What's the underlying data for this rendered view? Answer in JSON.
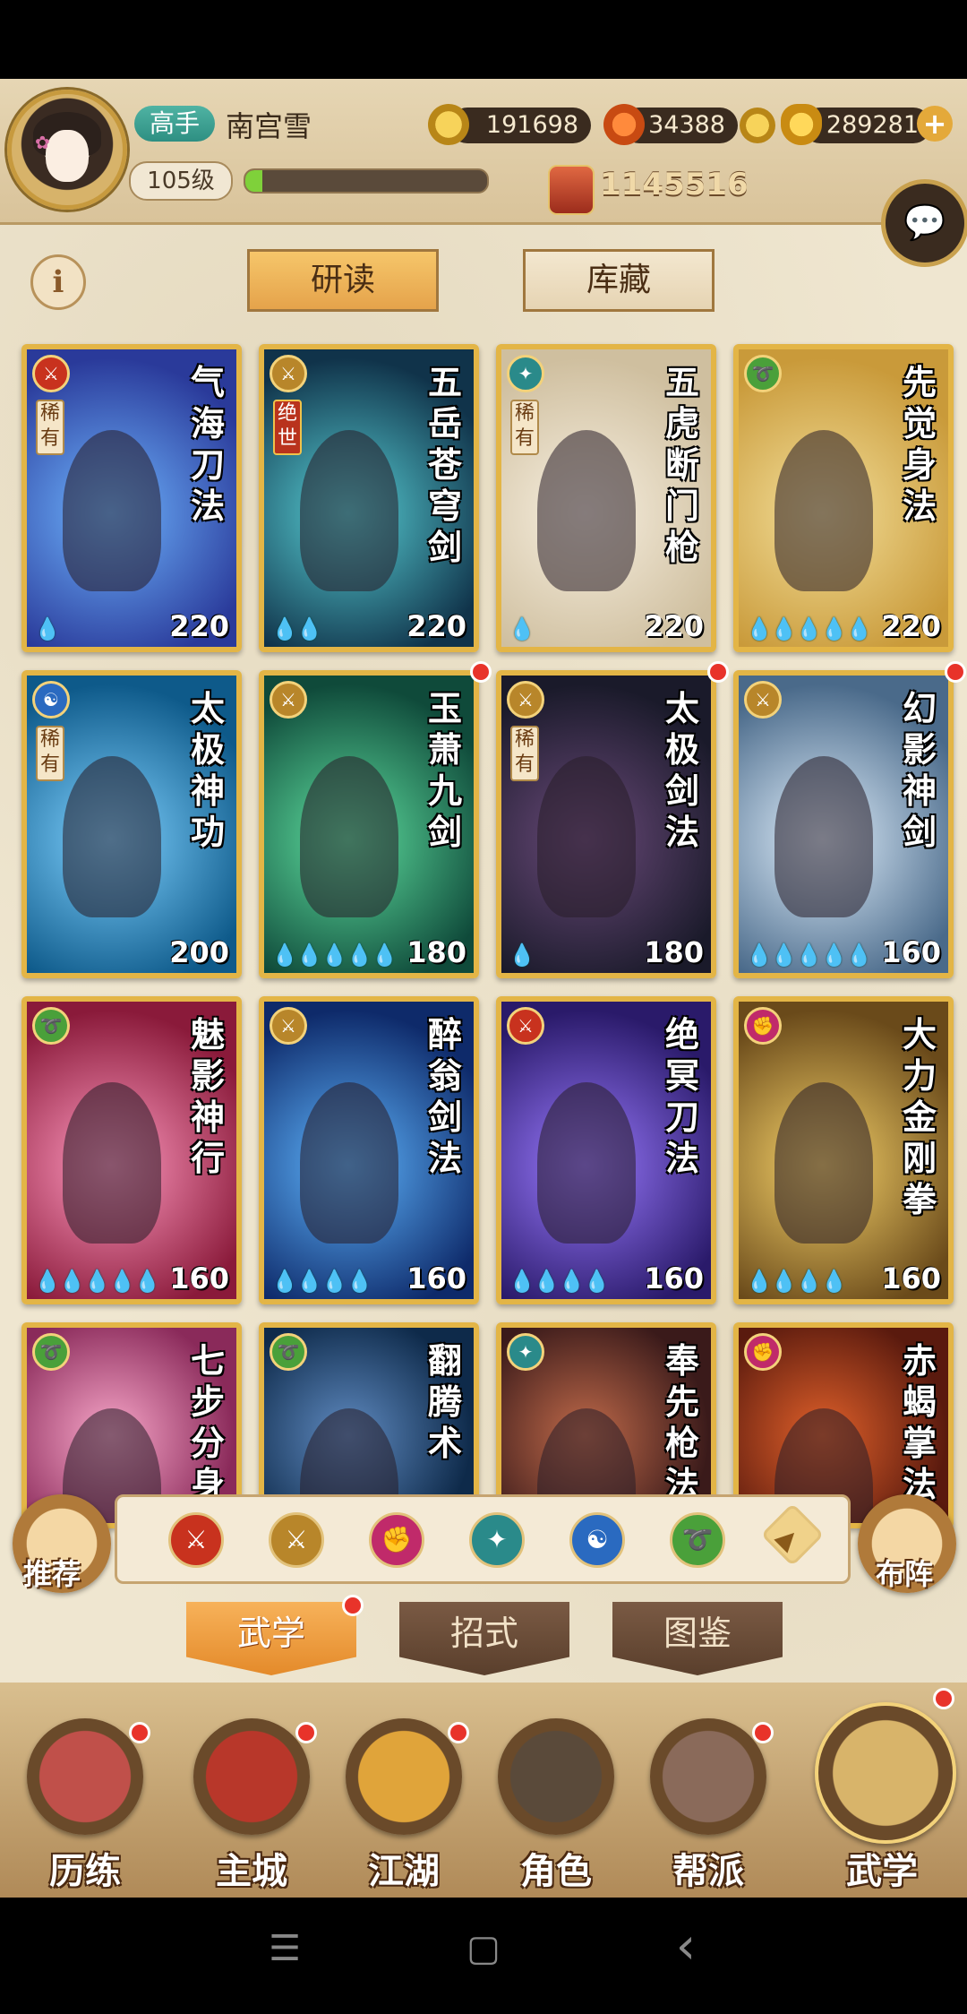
{
  "player": {
    "rank": "高手",
    "name": "南宫雪",
    "level": "105级",
    "exp_fraction": 0.07,
    "power": "1145516"
  },
  "currencies": {
    "coins": "191698",
    "leaves": "34388",
    "ingots": "289281"
  },
  "tabs": {
    "read": "研读",
    "storage": "库藏"
  },
  "cards": [
    {
      "name": "气海刀法",
      "rarity": "稀有",
      "drops": 1,
      "level": "220",
      "element": "red",
      "bg": [
        "#2a3a9a",
        "#6fb6ff"
      ],
      "dot": false
    },
    {
      "name": "五岳苍穹剑",
      "rarity": "绝世",
      "drops": 2,
      "level": "220",
      "element": "gold",
      "bg": [
        "#10334a",
        "#58d0d6"
      ],
      "dot": false
    },
    {
      "name": "五虎断门枪",
      "rarity": "稀有",
      "drops": 1,
      "level": "220",
      "element": "teal",
      "bg": [
        "#cfbf9f",
        "#f7efe0"
      ],
      "dot": false
    },
    {
      "name": "先觉身法",
      "rarity": "",
      "drops": 5,
      "level": "220",
      "element": "green",
      "bg": [
        "#c99a3a",
        "#f3df9a"
      ],
      "dot": false
    },
    {
      "name": "太极神功",
      "rarity": "稀有",
      "drops": 0,
      "level": "200",
      "element": "blue",
      "bg": [
        "#0e5a8a",
        "#7fd1ff"
      ],
      "dot": false
    },
    {
      "name": "玉萧九剑",
      "rarity": "",
      "drops": 5,
      "level": "180",
      "element": "gold",
      "bg": [
        "#0f4a3a",
        "#5fe0a0"
      ],
      "dot": true
    },
    {
      "name": "太极剑法",
      "rarity": "稀有",
      "drops": 1,
      "level": "180",
      "element": "gold",
      "bg": [
        "#1a1a2a",
        "#6a4a7a"
      ],
      "dot": true
    },
    {
      "name": "幻影神剑",
      "rarity": "",
      "drops": 5,
      "level": "160",
      "element": "gold",
      "bg": [
        "#4a6a8a",
        "#dfeefb"
      ],
      "dot": true
    },
    {
      "name": "魅影神行",
      "rarity": "",
      "drops": 5,
      "level": "160",
      "element": "green",
      "bg": [
        "#8a1a3a",
        "#ff9ac0"
      ],
      "dot": false
    },
    {
      "name": "醉翁剑法",
      "rarity": "",
      "drops": 4,
      "level": "160",
      "element": "gold",
      "bg": [
        "#0e2a6a",
        "#5fb6ff"
      ],
      "dot": false
    },
    {
      "name": "绝冥刀法",
      "rarity": "",
      "drops": 4,
      "level": "160",
      "element": "red",
      "bg": [
        "#2a1a6a",
        "#9a7aff"
      ],
      "dot": false
    },
    {
      "name": "大力金刚拳",
      "rarity": "",
      "drops": 4,
      "level": "160",
      "element": "pink",
      "bg": [
        "#6a4a1a",
        "#f7d36a"
      ],
      "dot": false
    },
    {
      "name": "七步分身",
      "rarity": "",
      "drops": 0,
      "level": "",
      "element": "green",
      "bg": [
        "#8a2a5a",
        "#f7a6c8"
      ],
      "dot": false
    },
    {
      "name": "翻腾术",
      "rarity": "",
      "drops": 0,
      "level": "",
      "element": "green",
      "bg": [
        "#0e2a4a",
        "#5f8ac0"
      ],
      "dot": false
    },
    {
      "name": "奉先枪法",
      "rarity": "",
      "drops": 0,
      "level": "",
      "element": "teal",
      "bg": [
        "#3a1a1a",
        "#c06a4a"
      ],
      "dot": false
    },
    {
      "name": "赤蝎掌法",
      "rarity": "",
      "drops": 0,
      "level": "",
      "element": "pink",
      "bg": [
        "#5a1a0e",
        "#e0602a"
      ],
      "dot": false
    }
  ],
  "element_colors": {
    "red": "#c8321e",
    "gold": "#b8862a",
    "teal": "#2a8a8a",
    "green": "#4aa03a",
    "blue": "#2a6ac0",
    "pink": "#c02a6a"
  },
  "filters": [
    "red",
    "gold",
    "pink",
    "teal",
    "blue",
    "green",
    "sort-icon"
  ],
  "side_buttons": {
    "recommend": "推荐",
    "formation": "布阵"
  },
  "sub_tabs": [
    "武学",
    "招式",
    "图鉴"
  ],
  "bottom_nav": [
    {
      "label": "历练",
      "dot": true
    },
    {
      "label": "主城",
      "dot": true
    },
    {
      "label": "江湖",
      "dot": true
    },
    {
      "label": "角色",
      "dot": false
    },
    {
      "label": "帮派",
      "dot": true
    },
    {
      "label": "武学",
      "dot": true
    }
  ],
  "system_nav": {
    "menu": "☰",
    "home": "▢",
    "back": "‹"
  }
}
